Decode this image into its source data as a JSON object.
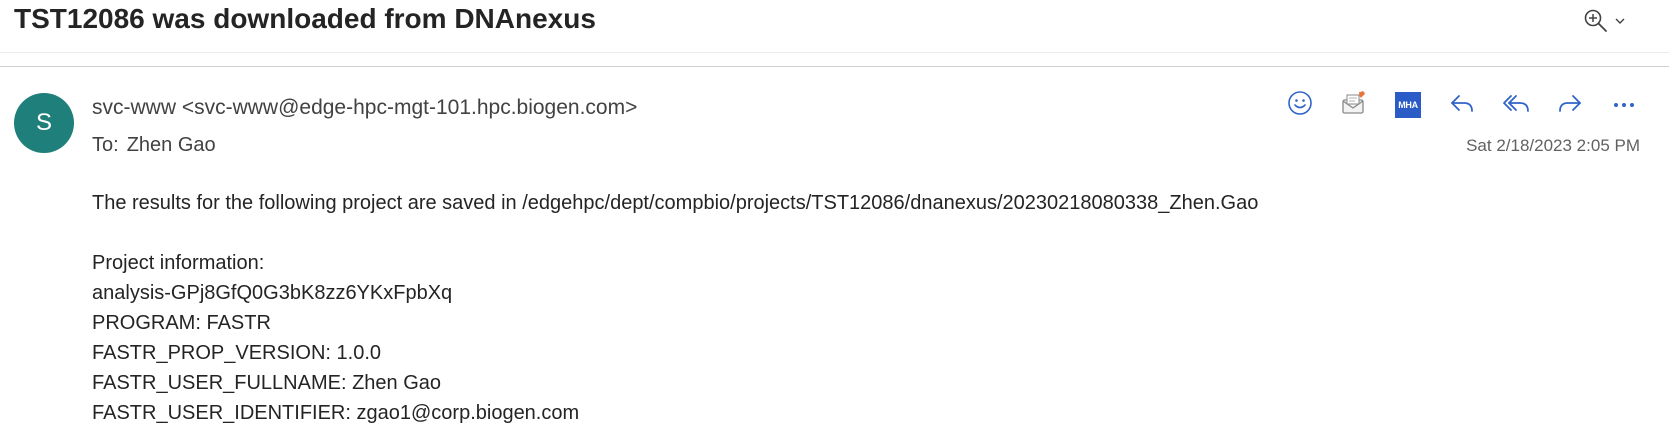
{
  "email": {
    "subject": "TST12086 was downloaded from DNAnexus",
    "sender": "svc-www <svc-www@edge-hpc-mgt-101.hpc.biogen.com>",
    "avatar_initial": "S",
    "to_label": "To:",
    "to_name": "Zhen Gao",
    "date": "Sat 2/18/2023 2:05 PM",
    "mha_label": "MHA",
    "body_intro": "The results for the following project are saved in /edgehpc/dept/compbio/projects/TST12086/dnanexus/20230218080338_Zhen.Gao",
    "body_lines": [
      "Project information:",
      "analysis-GPj8GfQ0G3bK8zz6YKxFpbXq",
      "PROGRAM: FASTR",
      "FASTR_PROP_VERSION: 1.0.0",
      "FASTR_USER_FULLNAME: Zhen Gao",
      "FASTR_USER_IDENTIFIER: zgao1@corp.biogen.com"
    ]
  },
  "colors": {
    "accent": "#2a5bc7",
    "avatar": "#1f7f7a",
    "icon_blue": "#3064c8"
  },
  "icons": {
    "zoom": "zoom-in-icon",
    "zoom_dropdown": "chevron-down-icon",
    "emoji": "smiley-icon",
    "report": "report-icon",
    "reply": "reply-icon",
    "reply_all": "reply-all-icon",
    "forward": "forward-icon",
    "more": "more-icon"
  }
}
